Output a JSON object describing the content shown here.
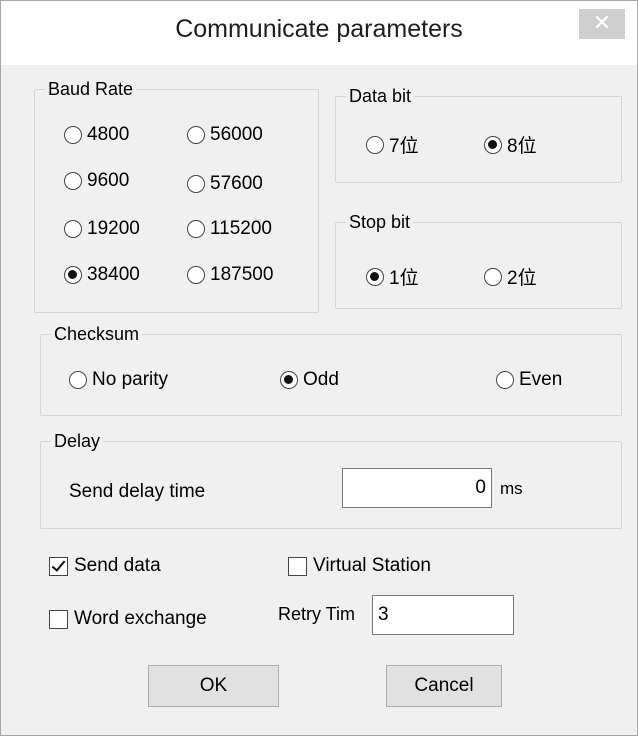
{
  "window": {
    "title": "Communicate parameters",
    "close_glyph": "✕"
  },
  "baud_rate": {
    "legend": "Baud Rate",
    "options": [
      "4800",
      "56000",
      "9600",
      "57600",
      "19200",
      "115200",
      "38400",
      "187500"
    ],
    "selected": "38400"
  },
  "data_bit": {
    "legend": "Data bit",
    "options": [
      "7位",
      "8位"
    ],
    "selected": "8位"
  },
  "stop_bit": {
    "legend": "Stop bit",
    "options": [
      "1位",
      "2位"
    ],
    "selected": "1位"
  },
  "checksum": {
    "legend": "Checksum",
    "options": [
      "No parity",
      "Odd",
      "Even"
    ],
    "selected": "Odd"
  },
  "delay": {
    "legend": "Delay",
    "send_delay_label": "Send delay time",
    "send_delay_value": "0",
    "unit": "ms"
  },
  "options": {
    "send_data": {
      "label": "Send data",
      "checked": true
    },
    "word_exchange": {
      "label": "Word exchange",
      "checked": false
    },
    "virtual_station": {
      "label": "Virtual Station",
      "checked": false
    },
    "retry_label": "Retry Tim",
    "retry_value": "3"
  },
  "buttons": {
    "ok": "OK",
    "cancel": "Cancel"
  }
}
